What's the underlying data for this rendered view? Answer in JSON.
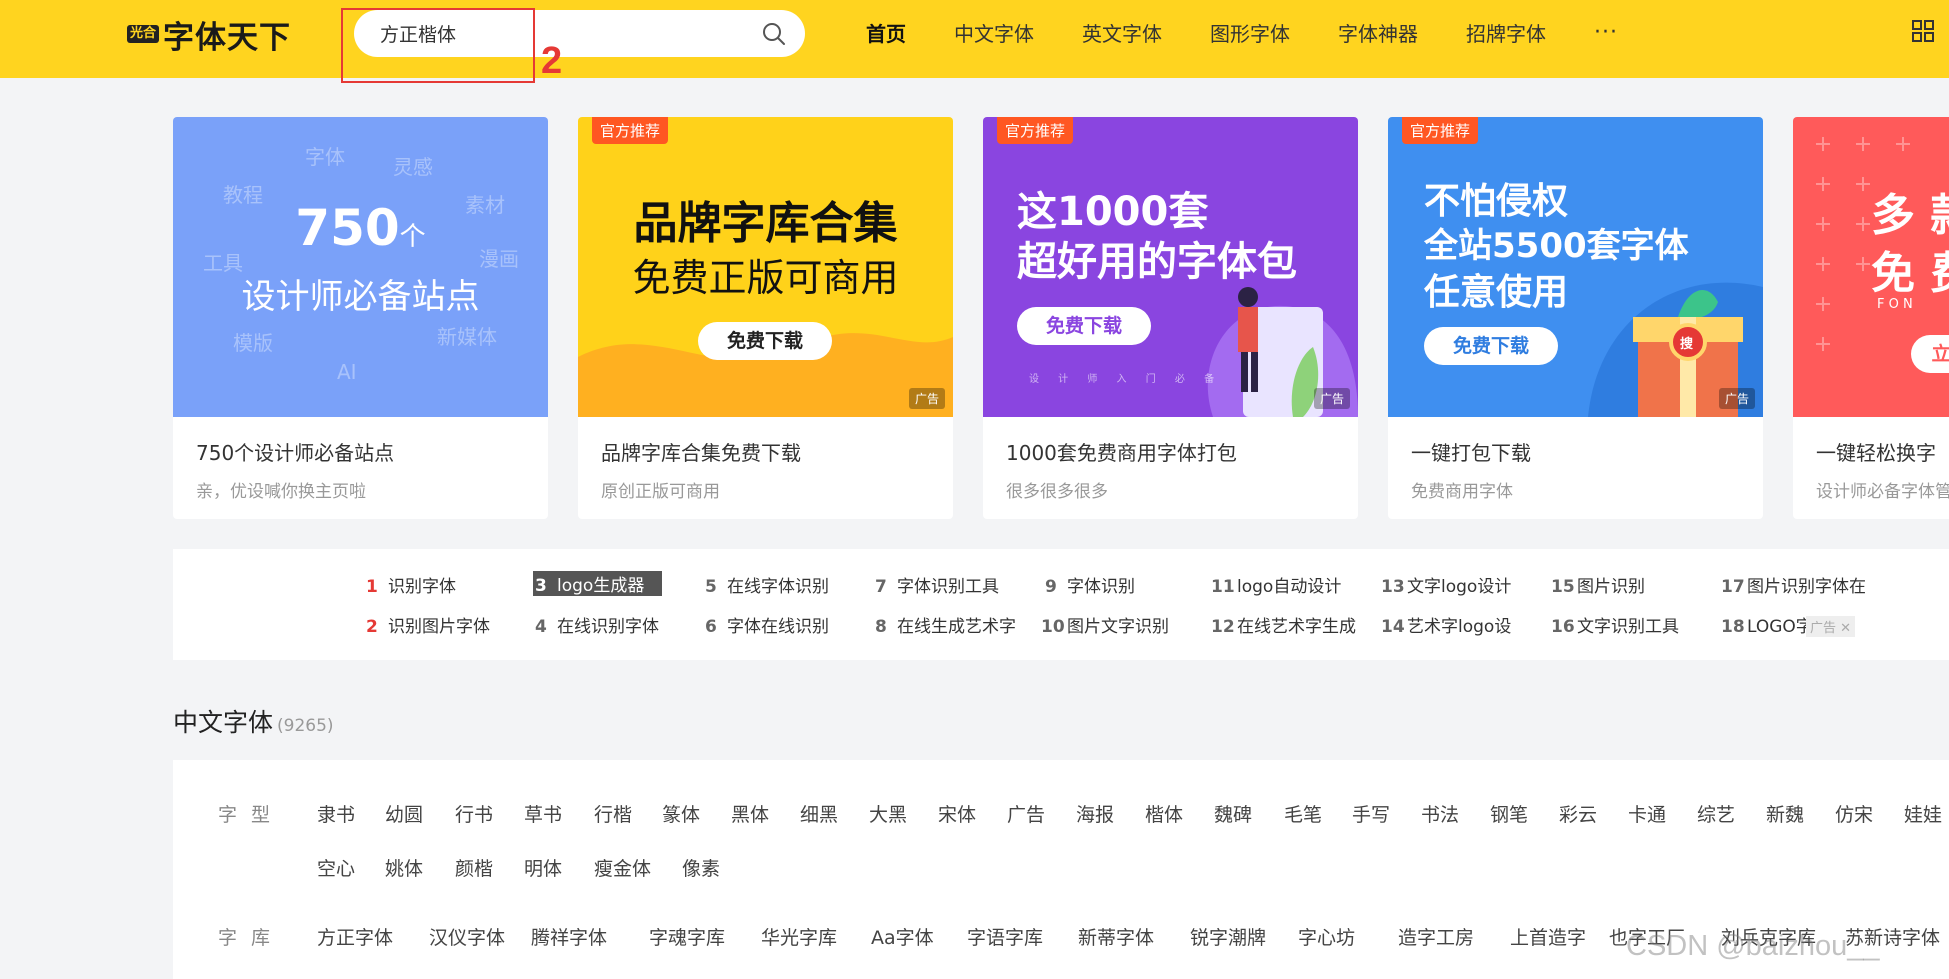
{
  "header": {
    "logo_badge": "光合",
    "logo_text": "字体天下",
    "search_value": "方正楷体",
    "annotation_number": "2",
    "nav": [
      "首页",
      "中文字体",
      "英文字体",
      "图形字体",
      "字体神器",
      "招牌字体"
    ],
    "nav_more": "···",
    "brand_color": "#ffd41f"
  },
  "banners": [
    {
      "title": "750个设计师必备站点",
      "subtitle": "亲，优设喊你换主页啦",
      "img_big": "750",
      "img_unit": "个",
      "img_line2": "设计师必备站点",
      "img_words": [
        "字体",
        "灵感",
        "教程",
        "素材",
        "工具",
        "漫画",
        "模版",
        "新媒体",
        "AI"
      ]
    },
    {
      "title": "品牌字库合集免费下载",
      "subtitle": "原创正版可商用",
      "tag": "官方推荐",
      "img_line1": "品牌字库合集",
      "img_line2": "免费正版可商用",
      "button": "免费下载",
      "ad": "广告"
    },
    {
      "title": "1000套免费商用字体打包",
      "subtitle": "很多很多很多",
      "tag": "官方推荐",
      "img_line1": "这1000套",
      "img_line2": "超好用的字体包",
      "button": "免费下载",
      "img_small": "设 计 师 入 门 必 备",
      "ad": "广告"
    },
    {
      "title": "一键打包下载",
      "subtitle": "免费商用字体",
      "tag": "官方推荐",
      "img_line1": "不怕侵权",
      "img_line2": "全站5500套字体",
      "img_line3": "任意使用",
      "button": "免费下载",
      "box_label": "搜",
      "ad": "广告"
    },
    {
      "title": "一键轻松换字",
      "subtitle": "设计师必备字体管",
      "img_line1": "多 款",
      "img_line2": "免 费",
      "img_small": "F O N",
      "button": "立"
    }
  ],
  "keywords": [
    {
      "num": "1",
      "label": "识别字体"
    },
    {
      "num": "2",
      "label": "识别图片字体"
    },
    {
      "num": "3",
      "label": "logo生成器"
    },
    {
      "num": "4",
      "label": "在线识别字体"
    },
    {
      "num": "5",
      "label": "在线字体识别"
    },
    {
      "num": "6",
      "label": "字体在线识别"
    },
    {
      "num": "7",
      "label": "字体识别工具"
    },
    {
      "num": "8",
      "label": "在线生成艺术字"
    },
    {
      "num": "9",
      "label": "字体识别"
    },
    {
      "num": "10",
      "label": "图片文字识别"
    },
    {
      "num": "11",
      "label": "logo自动设计"
    },
    {
      "num": "12",
      "label": "在线艺术字生成"
    },
    {
      "num": "13",
      "label": "文字logo设计"
    },
    {
      "num": "14",
      "label": "艺术字logo设"
    },
    {
      "num": "15",
      "label": "图片识别"
    },
    {
      "num": "16",
      "label": "文字识别工具"
    },
    {
      "num": "17",
      "label": "图片识别字体在"
    },
    {
      "num": "18",
      "label": "LOGO字体"
    }
  ],
  "kw_ad": "广告 ✕",
  "section": {
    "title": "中文字体",
    "count": "(9265)",
    "type_label": "字型",
    "types_row1": [
      "隶书",
      "幼圆",
      "行书",
      "草书",
      "行楷",
      "篆体",
      "黑体",
      "细黑",
      "大黑",
      "宋体",
      "广告",
      "海报",
      "楷体",
      "魏碑",
      "毛笔",
      "手写",
      "书法",
      "钢笔",
      "彩云",
      "卡通",
      "综艺",
      "新魏",
      "仿宋",
      "娃娃"
    ],
    "types_row2": [
      "空心",
      "姚体",
      "颜楷",
      "明体",
      "瘦金体",
      "像素"
    ],
    "lib_label": "字库",
    "libs": [
      "方正字体",
      "汉仪字体",
      "腾祥字体",
      "字魂字库",
      "华光字库",
      "Aa字体",
      "字语字库",
      "新蒂字体",
      "锐字潮牌",
      "字心坊",
      "造字工房",
      "上首造字",
      "也字工厂",
      "刘兵克字库",
      "苏新诗字体"
    ]
  },
  "watermark": "CSDN @baizhou__"
}
